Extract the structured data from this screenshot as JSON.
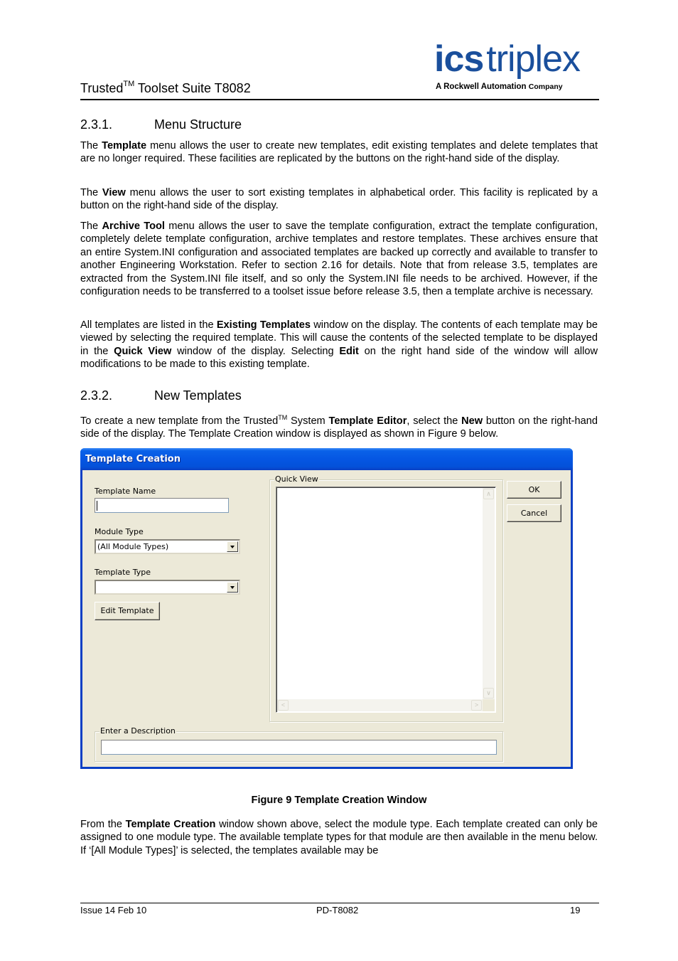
{
  "header": {
    "title_prefix": "Trusted",
    "title_tm": "TM",
    "title_suffix": " Toolset Suite T8082",
    "logo": {
      "ics": "ics",
      "triplex": "triplex",
      "tagline": "A Rockwell Automation",
      "tagline_company": "Company",
      "color": "#1a4f9c"
    }
  },
  "sections": [
    {
      "number": "2.3.1.",
      "title": "Menu Structure",
      "paragraphs": [
        {
          "parts": [
            "The ",
            {
              "b": "Template"
            },
            " menu allows the user to create new templates, edit existing templates and delete templates that are no longer required.  These facilities are replicated by the buttons on the right-hand side of the display."
          ]
        },
        {
          "parts": [
            "The ",
            {
              "b": "View"
            },
            " menu allows the user to sort existing templates in alphabetical order.  This facility is replicated by a button on the right-hand side of the display."
          ]
        },
        {
          "parts": [
            "The ",
            {
              "b": "Archive Tool"
            },
            " menu allows the user to save the template configuration, extract the template configuration, completely delete template configuration, archive templates and restore templates. These archives ensure that an entire System.INI configuration and associated templates are backed up correctly and available to transfer to another Engineering Workstation. Refer to section 2.16 for details. Note that from release 3.5, templates are extracted from the System.INI file itself, and so only the System.INI file needs to be archived. However, if the configuration needs to be transferred to a toolset issue before release 3.5, then a template archive is necessary."
          ]
        },
        {
          "parts": [
            "All templates are listed in the ",
            {
              "b": "Existing Templates"
            },
            " window on the display.  The contents of each template may be viewed by selecting the required template. This will cause the contents of the selected template to be displayed in the ",
            {
              "b": "Quick View"
            },
            " window of the display. Selecting ",
            {
              "b": "Edit"
            },
            " on the right hand side of the window will allow modifications to be made to this existing template."
          ]
        }
      ]
    },
    {
      "number": "2.3.2.",
      "title": "New Templates",
      "paragraphs": [
        {
          "parts": [
            "To create a new template from the Trusted",
            {
              "sup": "TM"
            },
            " System ",
            {
              "b": "Template Editor"
            },
            ", select the ",
            {
              "b": "New"
            },
            " button on the right-hand side of the display.  The Template Creation window is displayed as shown in Figure 9 below."
          ]
        }
      ]
    }
  ],
  "dialog": {
    "title": "Template Creation",
    "template_name_label": "Template Name",
    "template_name_value": "",
    "module_type_label": "Module Type",
    "module_type_value": "(All Module Types)",
    "template_type_label": "Template Type",
    "template_type_value": "",
    "edit_template_button": "Edit Template",
    "quick_view_label": "Quick View",
    "ok_button": "OK",
    "cancel_button": "Cancel",
    "description_label": "Enter a Description",
    "description_value": ""
  },
  "figure_caption": "Figure 9 Template Creation Window",
  "after_figure": {
    "parts": [
      "From the ",
      {
        "b": "Template Creation"
      },
      " window shown above, select the module type. Each template created can only be assigned to one module type.  The available template types for that module are then available in the menu below. If ‘[All Module Types]’ is selected, the templates available may be"
    ]
  },
  "footer": {
    "left": "Issue 14 Feb 10",
    "center": "PD-T8082",
    "right": "19"
  }
}
